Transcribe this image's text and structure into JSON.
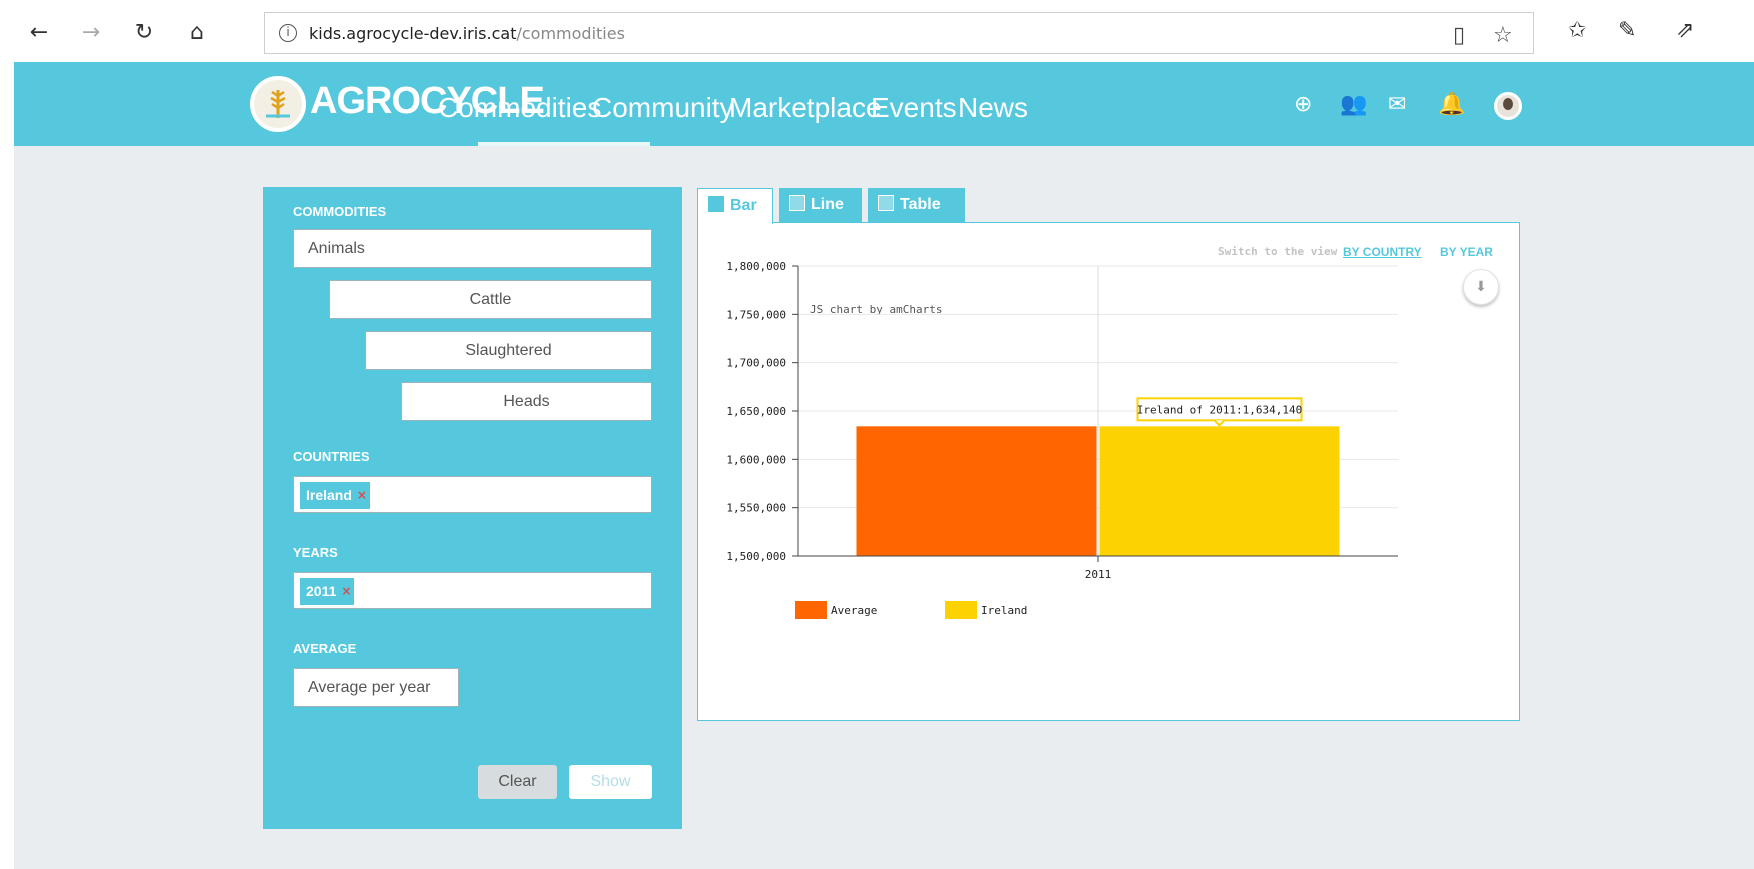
{
  "browser": {
    "url_host": "kids.agrocycle-dev.iris.cat",
    "url_path": "/commodities",
    "info_icon": "i"
  },
  "header": {
    "brand": "AGROCYCLE",
    "nav": [
      "Commodities",
      "Community",
      "Marketplace",
      "Events",
      "News"
    ],
    "active_nav": "Commodities",
    "background": "#56c8dd"
  },
  "filters": {
    "commodities_label": "COMMODITIES",
    "commodity_levels": [
      "Animals",
      "Cattle",
      "Slaughtered",
      "Heads"
    ],
    "countries_label": "COUNTRIES",
    "country_tag": "Ireland",
    "years_label": "YEARS",
    "year_tag": "2011",
    "average_label": "AVERAGE",
    "average_value": "Average per year",
    "clear_label": "Clear",
    "show_label": "Show",
    "tag_remove": "×"
  },
  "chart_view": {
    "tabs": [
      "Bar",
      "Line",
      "Table"
    ],
    "active_tab": "Bar",
    "switch_text": "Switch to the view",
    "by_country": "BY COUNTRY",
    "by_year": "BY YEAR",
    "credit": "JS chart by amCharts",
    "tooltip": "Ireland of 2011:1,634,140",
    "download_icon": "⬇"
  },
  "chart_data": {
    "type": "bar",
    "categories": [
      "2011"
    ],
    "series": [
      {
        "name": "Average",
        "values": [
          1634140
        ],
        "color": "#ff6600"
      },
      {
        "name": "Ireland",
        "values": [
          1634140
        ],
        "color": "#fcd202"
      }
    ],
    "ylim": [
      1500000,
      1800000
    ],
    "yticks": [
      "1,500,000",
      "1,550,000",
      "1,600,000",
      "1,650,000",
      "1,700,000",
      "1,750,000",
      "1,800,000"
    ],
    "ytick_values": [
      1500000,
      1550000,
      1600000,
      1650000,
      1700000,
      1750000,
      1800000
    ],
    "grid": true,
    "legend": "bottom-left"
  }
}
